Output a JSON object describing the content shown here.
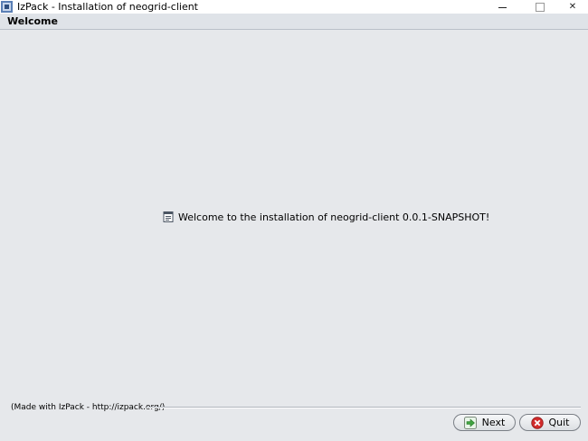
{
  "window": {
    "title": "IzPack - Installation of  neogrid-client",
    "minimize_icon": "minimize-icon",
    "maximize_icon": "maximize-icon",
    "close_icon": "close-icon",
    "close_glyph": "✕"
  },
  "header": {
    "title": "Welcome"
  },
  "main": {
    "welcome_text": "Welcome to the installation of neogrid-client 0.0.1-SNAPSHOT!",
    "icon": "document-icon"
  },
  "footer": {
    "made_with": "(Made with IzPack - http://izpack.org/)",
    "next_label": "Next",
    "quit_label": "Quit"
  },
  "colors": {
    "background": "#e6e8eb",
    "next_arrow": "#3fa33f",
    "quit_icon": "#d22b2b"
  }
}
